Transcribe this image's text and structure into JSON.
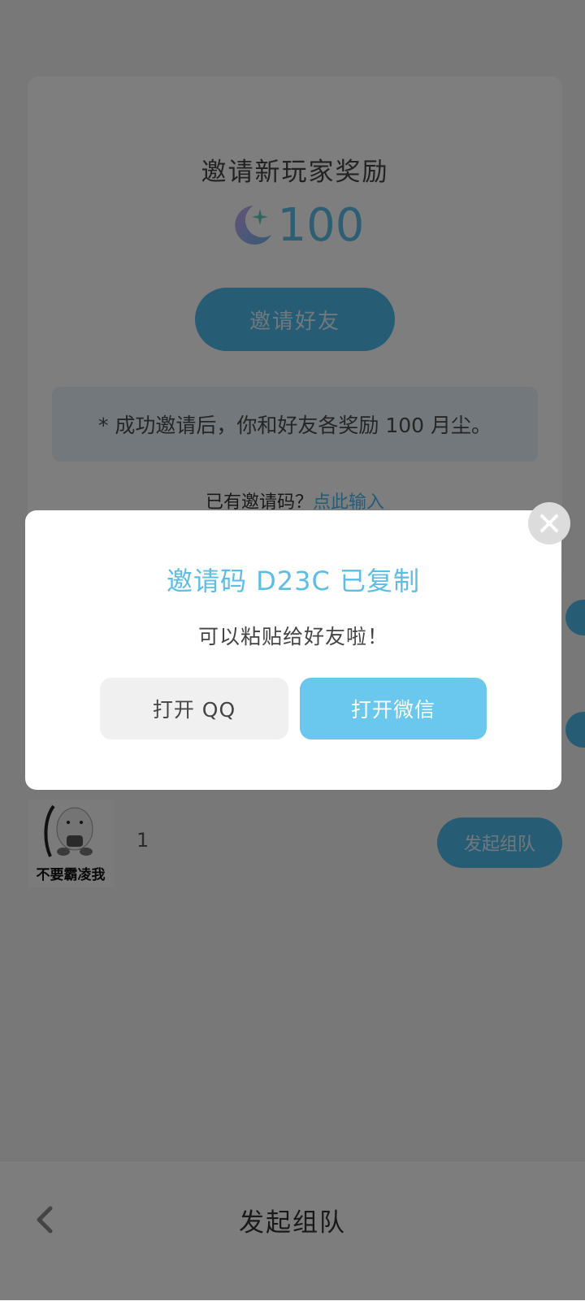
{
  "invite_card": {
    "title": "邀请新玩家奖励",
    "reward_amount": "100",
    "reward_icon": "moon-star-icon",
    "invite_button_label": "邀请好友",
    "notice": "* 成功邀请后，你和好友各奖励 100 月尘。",
    "has_code_prefix": "已有邀请码？",
    "has_code_link": "点此输入"
  },
  "team_row": {
    "avatar_caption": "不要霸凌我",
    "count": "1",
    "start_button_label": "发起组队"
  },
  "bottom_bar": {
    "title": "发起组队",
    "back_icon": "chevron-left-icon"
  },
  "dialog": {
    "title": "邀请码 D23C 已复制",
    "subtitle": "可以粘贴给好友啦！",
    "qq_button_label": "打开 QQ",
    "wechat_button_label": "打开微信",
    "close_icon": "close-icon"
  },
  "colors": {
    "accent": "#4fb8ea",
    "accent_light": "#6ac8ee",
    "overlay": "rgba(0,0,0,0.5)"
  }
}
